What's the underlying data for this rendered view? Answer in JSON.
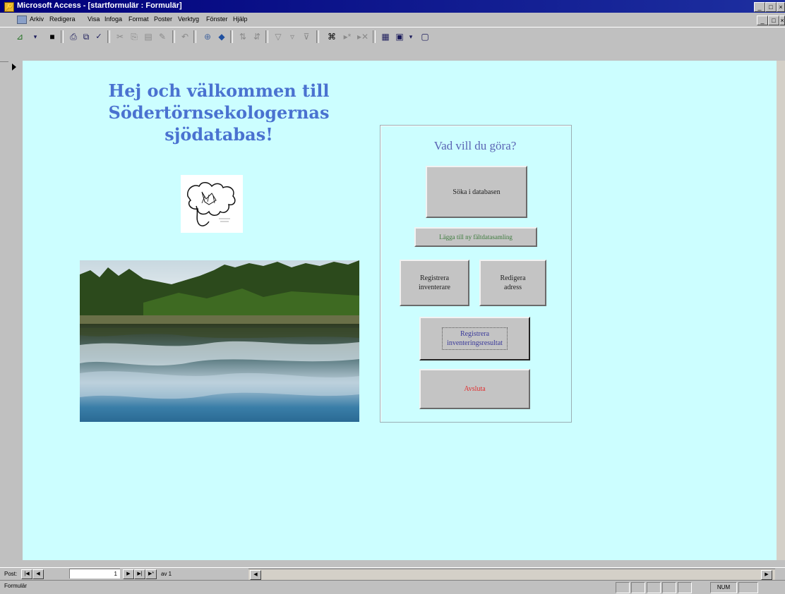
{
  "window": {
    "title": "Microsoft Access - [startformulär : Formulär]",
    "controls": [
      "_",
      "□",
      "×"
    ],
    "doc_controls": [
      "_",
      "□",
      "×"
    ]
  },
  "menu": {
    "items": [
      "Arkiv",
      "Redigera",
      "Visa",
      "Infoga",
      "Format",
      "Poster",
      "Verktyg",
      "Fönster",
      "Hjälp"
    ]
  },
  "toolbar": {
    "icons": [
      "view-icon",
      "save-icon",
      "print-icon",
      "print-preview-icon",
      "spelling-icon",
      "cut-icon",
      "copy-icon",
      "paste-icon",
      "format-painter-icon",
      "undo-icon",
      "hyperlink-icon",
      "web-icon",
      "sort-ascending-icon",
      "sort-descending-icon",
      "filter-by-selection-icon",
      "filter-by-form-icon",
      "apply-filter-icon",
      "find-icon",
      "new-record-icon",
      "delete-record-icon",
      "database-window-icon",
      "new-object-icon",
      "help-icon"
    ]
  },
  "form": {
    "heading_line1": "Hej och välkommen till",
    "heading_line2": "Södertörnsekologernas",
    "heading_line3": "sjödatabas!",
    "panel_title": "Vad vill du göra?",
    "buttons": {
      "search": "Söka i databasen",
      "add_lake": "Lägga till ny fältdatasamling",
      "register_inventory_line1": "Registrera",
      "register_inventory_line2": "inventerare",
      "edit_address_line1": "Redigera",
      "edit_address_line2": "adress",
      "register_result_line1": "Registrera",
      "register_result_line2": "inventeringsresultat",
      "quit": "Avsluta"
    },
    "quit_color": "#e03030",
    "background_color": "#ccfeff",
    "heading_color": "#4a72d0"
  },
  "navigation": {
    "label": "Post:",
    "current_record": "1",
    "of_label": "av 1"
  },
  "status": {
    "left_text": "Formulär",
    "num": "NUM"
  }
}
